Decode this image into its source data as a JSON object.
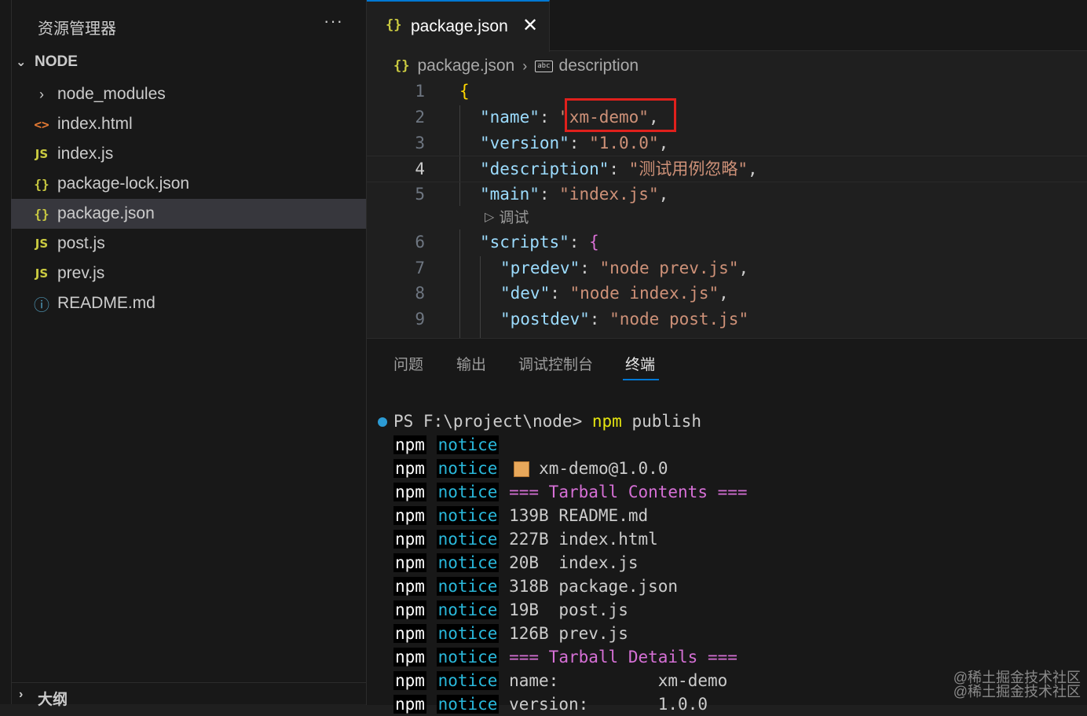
{
  "sidebar": {
    "header": "资源管理器",
    "more": "···",
    "section": "NODE",
    "items": [
      {
        "label": "node_modules",
        "icon": "chevron-right-icon",
        "glyph": "›"
      },
      {
        "label": "index.html",
        "icon": "html-icon",
        "glyph": "<>"
      },
      {
        "label": "index.js",
        "icon": "js-icon",
        "glyph": "JS"
      },
      {
        "label": "package-lock.json",
        "icon": "json-icon",
        "glyph": "{}"
      },
      {
        "label": "package.json",
        "icon": "json-icon",
        "glyph": "{}"
      },
      {
        "label": "post.js",
        "icon": "js-icon",
        "glyph": "JS"
      },
      {
        "label": "prev.js",
        "icon": "js-icon",
        "glyph": "JS"
      },
      {
        "label": "README.md",
        "icon": "info-icon",
        "glyph": "ⓘ"
      }
    ],
    "outline": "大纲"
  },
  "editor": {
    "tab": {
      "label": "package.json",
      "glyph": "{}",
      "close": "✕"
    },
    "breadcrumb": {
      "file": "package.json",
      "glyph": "{}",
      "sep": "›",
      "symbol_glyph": "abc",
      "symbol": "description"
    },
    "lines": [
      {
        "n": "1"
      },
      {
        "n": "2"
      },
      {
        "n": "3"
      },
      {
        "n": "4"
      },
      {
        "n": "5"
      },
      {
        "n": "6"
      },
      {
        "n": "7"
      },
      {
        "n": "8"
      },
      {
        "n": "9"
      }
    ],
    "code": {
      "l1_open": "{",
      "l2_key": "\"name\"",
      "l2_val": "\"xm-demo\"",
      "l3_key": "\"version\"",
      "l3_val": "\"1.0.0\"",
      "l4_key": "\"description\"",
      "l4_val": "\"测试用例忽略\"",
      "l5_key": "\"main\"",
      "l5_val": "\"index.js\"",
      "l6_key": "\"scripts\"",
      "l6_open": "{",
      "l7_key": "\"predev\"",
      "l7_val": "\"node prev.js\"",
      "l8_key": "\"dev\"",
      "l8_val": "\"node index.js\"",
      "l9_key": "\"postdev\"",
      "l9_val": "\"node post.js\"",
      "colon": ": ",
      "comma": ","
    },
    "codelens": {
      "label": "调试",
      "glyph": "▷"
    }
  },
  "panel": {
    "tabs": [
      "问题",
      "输出",
      "调试控制台",
      "终端"
    ],
    "active_tab": "终端",
    "terminal": {
      "prompt": "PS F:\\project\\node> ",
      "cmd": "npm",
      "cmd_arg": " publish",
      "npm": "npm",
      "notice": "notice",
      "pkg_name": "xm-demo@1.0.0",
      "tarball_contents": "=== Tarball Contents ===",
      "files": [
        {
          "size": "139B",
          "name": "README.md"
        },
        {
          "size": "227B",
          "name": "index.html"
        },
        {
          "size": "20B ",
          "name": "index.js"
        },
        {
          "size": "318B",
          "name": "package.json"
        },
        {
          "size": "19B ",
          "name": "post.js"
        },
        {
          "size": "126B",
          "name": "prev.js"
        }
      ],
      "tarball_details": "=== Tarball Details ===",
      "details": [
        {
          "key": "name:          ",
          "value": "xm-demo"
        },
        {
          "key": "version:       ",
          "value": "1.0.0"
        }
      ]
    }
  },
  "watermark": [
    "@稀土掘金技术社区",
    "@稀土掘金技术社区"
  ]
}
